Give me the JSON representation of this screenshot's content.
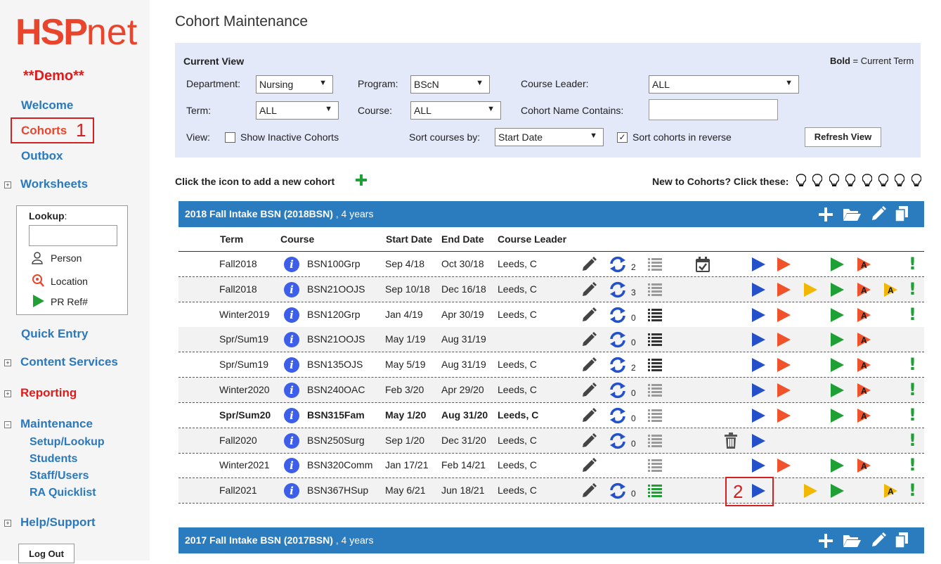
{
  "sidebar": {
    "logo_bold": "HSP",
    "logo_rest": "net",
    "demo": "**Demo**",
    "welcome": "Welcome",
    "cohorts": "Cohorts",
    "cohorts_callout": "1",
    "outbox": "Outbox",
    "worksheets": "Worksheets",
    "lookup_label": "Lookup",
    "lookup_colon": ":",
    "lookup_items": [
      "Person",
      "Location",
      "PR Ref#"
    ],
    "quick_entry": "Quick Entry",
    "content_services": "Content Services",
    "reporting": "Reporting",
    "maintenance": "Maintenance",
    "maintenance_items": [
      "Setup/Lookup",
      "Students",
      "Staff/Users",
      "RA Quicklist"
    ],
    "help_support": "Help/Support",
    "logout": "Log Out",
    "expand_plus": "+",
    "expand_minus": "−"
  },
  "page": {
    "title": "Cohort Maintenance"
  },
  "filters": {
    "heading": "Current View",
    "bold_note_bold": "Bold",
    "bold_note_rest": " = Current Term",
    "department_label": "Department:",
    "department_value": "Nursing",
    "program_label": "Program:",
    "program_value": "BScN",
    "course_leader_label": "Course Leader:",
    "course_leader_value": "ALL",
    "term_label": "Term:",
    "term_value": "ALL",
    "course_label": "Course:",
    "course_value": "ALL",
    "cohort_name_label": "Cohort Name Contains:",
    "cohort_name_value": "",
    "view_label": "View:",
    "show_inactive_label": "Show Inactive Cohorts",
    "show_inactive_checked": false,
    "sort_courses_label": "Sort courses by:",
    "sort_courses_value": "Start Date",
    "sort_reverse_label": "Sort cohorts in reverse",
    "sort_reverse_checked": true,
    "refresh_button": "Refresh View",
    "check_mark": "✓",
    "caret": "▼"
  },
  "add_cohort": {
    "prompt": "Click the icon to add a new cohort",
    "plus": "+",
    "new_to_cohorts": "New to Cohorts? Click these:",
    "bulb_count": 8
  },
  "cohort_groups": [
    {
      "name": "2018 Fall Intake BSN (2018BSN)",
      "duration": " , 4 years"
    },
    {
      "name": "2017 Fall Intake BSN (2017BSN)",
      "duration": " , 4 years"
    }
  ],
  "table": {
    "columns": [
      "Term",
      "Course",
      "Start Date",
      "End Date",
      "Course Leader"
    ],
    "rows": [
      {
        "term": "Fall2018",
        "course": "BSN100Grp",
        "start": "Sep 4/18",
        "end": "Oct 30/18",
        "leader": "Leeds, C",
        "count": "2",
        "bold": false
      },
      {
        "term": "Fall2018",
        "course": "BSN21OOJS",
        "start": "Sep 10/18",
        "end": "Dec 16/18",
        "leader": "Leeds, C",
        "count": "3",
        "bold": false
      },
      {
        "term": "Winter2019",
        "course": "BSN120Grp",
        "start": "Jan 4/19",
        "end": "Apr 30/19",
        "leader": "Leeds, C",
        "count": "0",
        "bold": false
      },
      {
        "term": "Spr/Sum19",
        "course": "BSN21OOJS",
        "start": "May 1/19",
        "end": "Aug 31/19",
        "leader": "",
        "count": "0",
        "bold": false
      },
      {
        "term": "Spr/Sum19",
        "course": "BSN135OJS",
        "start": "May 5/19",
        "end": "Aug 31/19",
        "leader": "Leeds, C",
        "count": "2",
        "bold": false
      },
      {
        "term": "Winter2020",
        "course": "BSN240OAC",
        "start": "Feb 3/20",
        "end": "Apr 29/20",
        "leader": "Leeds, C",
        "count": "0",
        "bold": false
      },
      {
        "term": "Spr/Sum20",
        "course": "BSN315Fam",
        "start": "May 1/20",
        "end": "Aug 31/20",
        "leader": "Leeds, C",
        "count": "0",
        "bold": true
      },
      {
        "term": "Fall2020",
        "course": "BSN250Surg",
        "start": "Sep 1/20",
        "end": "Dec 31/20",
        "leader": "Leeds, C",
        "count": "0",
        "bold": false
      },
      {
        "term": "Winter2021",
        "course": "BSN320Comm",
        "start": "Jan 17/21",
        "end": "Feb 14/21",
        "leader": "Leeds, C",
        "count": "",
        "bold": false
      },
      {
        "term": "Fall2021",
        "course": "BSN367HSup",
        "start": "May 6/21",
        "end": "Jun 18/21",
        "leader": "Leeds, C",
        "count": "0",
        "bold": false
      }
    ]
  },
  "annotation": {
    "callout_2": "2"
  },
  "glyphs": {
    "info": "i",
    "bang": "!",
    "bulb": "💡",
    "A": "A"
  },
  "colors": {
    "accent_blue": "#2b7bbf",
    "link_blue": "#2a78bd",
    "red": "#e01b1b",
    "play_blue": "#2451c9",
    "play_orange": "#f0532c",
    "play_yellow": "#f2b705",
    "play_green": "#1fa035",
    "panel_bg": "#e4e9fa"
  },
  "icons": [
    "person-icon",
    "location-icon",
    "pr-ref-icon",
    "pencil-icon",
    "sync-icon",
    "list-icon",
    "calendar-check-icon",
    "trash-icon",
    "play-icon",
    "info-icon",
    "plus-icon",
    "folder-open-icon",
    "copy-icon",
    "lightbulb-icon"
  ]
}
